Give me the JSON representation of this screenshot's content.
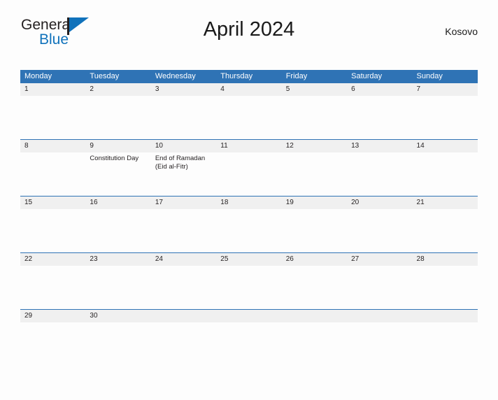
{
  "brand": {
    "name_part1": "General",
    "name_part2": "Blue",
    "flag_icon": "flag-triangle-icon",
    "colors": {
      "dark": "#231f20",
      "blue": "#1072bb"
    }
  },
  "header": {
    "title": "April 2024",
    "country": "Kosovo"
  },
  "calendar": {
    "accent_color": "#2f73b5",
    "date_band_color": "#f0f0f0",
    "weekdays": [
      "Monday",
      "Tuesday",
      "Wednesday",
      "Thursday",
      "Friday",
      "Saturday",
      "Sunday"
    ],
    "weeks": [
      {
        "days": [
          {
            "date": "1",
            "events": []
          },
          {
            "date": "2",
            "events": []
          },
          {
            "date": "3",
            "events": []
          },
          {
            "date": "4",
            "events": []
          },
          {
            "date": "5",
            "events": []
          },
          {
            "date": "6",
            "events": []
          },
          {
            "date": "7",
            "events": []
          }
        ]
      },
      {
        "days": [
          {
            "date": "8",
            "events": []
          },
          {
            "date": "9",
            "events": [
              "Constitution Day"
            ]
          },
          {
            "date": "10",
            "events": [
              "End of Ramadan",
              "(Eid al-Fitr)"
            ]
          },
          {
            "date": "11",
            "events": []
          },
          {
            "date": "12",
            "events": []
          },
          {
            "date": "13",
            "events": []
          },
          {
            "date": "14",
            "events": []
          }
        ]
      },
      {
        "days": [
          {
            "date": "15",
            "events": []
          },
          {
            "date": "16",
            "events": []
          },
          {
            "date": "17",
            "events": []
          },
          {
            "date": "18",
            "events": []
          },
          {
            "date": "19",
            "events": []
          },
          {
            "date": "20",
            "events": []
          },
          {
            "date": "21",
            "events": []
          }
        ]
      },
      {
        "days": [
          {
            "date": "22",
            "events": []
          },
          {
            "date": "23",
            "events": []
          },
          {
            "date": "24",
            "events": []
          },
          {
            "date": "25",
            "events": []
          },
          {
            "date": "26",
            "events": []
          },
          {
            "date": "27",
            "events": []
          },
          {
            "date": "28",
            "events": []
          }
        ]
      },
      {
        "days": [
          {
            "date": "29",
            "events": []
          },
          {
            "date": "30",
            "events": []
          },
          {
            "date": "",
            "events": []
          },
          {
            "date": "",
            "events": []
          },
          {
            "date": "",
            "events": []
          },
          {
            "date": "",
            "events": []
          },
          {
            "date": "",
            "events": []
          }
        ]
      }
    ]
  }
}
